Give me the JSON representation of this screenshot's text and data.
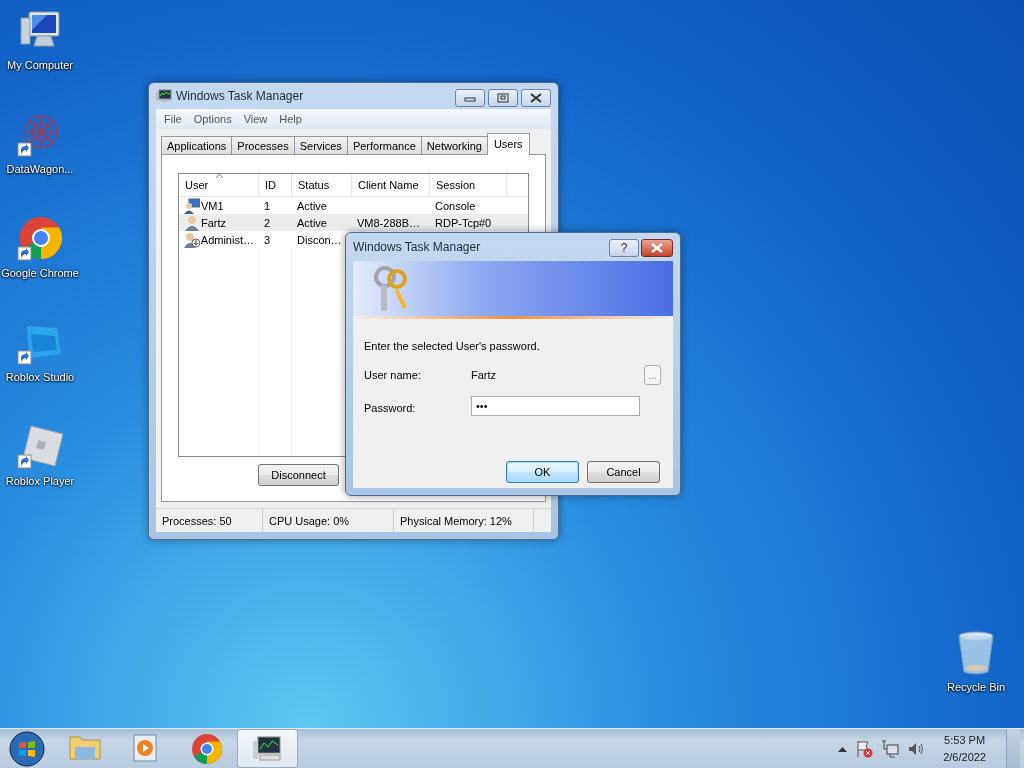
{
  "desktop_icons": [
    {
      "label": "My Computer",
      "kind": "computer",
      "shortcut": false
    },
    {
      "label": "DataWagon...",
      "kind": "network",
      "shortcut": true
    },
    {
      "label": "Google Chrome",
      "kind": "chrome",
      "shortcut": true
    },
    {
      "label": "Roblox Studio",
      "kind": "studio",
      "shortcut": true
    },
    {
      "label": "Roblox Player",
      "kind": "player",
      "shortcut": true
    }
  ],
  "recycle_bin": {
    "label": "Recycle Bin"
  },
  "task_manager": {
    "title": "Windows Task Manager",
    "menu": [
      "File",
      "Options",
      "View",
      "Help"
    ],
    "tabs": [
      {
        "label": "Applications",
        "selected": false
      },
      {
        "label": "Processes",
        "selected": false
      },
      {
        "label": "Services",
        "selected": false
      },
      {
        "label": "Performance",
        "selected": false
      },
      {
        "label": "Networking",
        "selected": false
      },
      {
        "label": "Users",
        "selected": true
      }
    ],
    "columns": [
      "User",
      "ID",
      "Status",
      "Client Name",
      "Session"
    ],
    "rows": [
      {
        "kind": "console",
        "selected": false,
        "cells": [
          "VM1",
          "1",
          "Active",
          "",
          "Console"
        ]
      },
      {
        "kind": "user",
        "selected": true,
        "cells": [
          "Fartz",
          "2",
          "Active",
          "VM8-288B…",
          "RDP-Tcp#0"
        ]
      },
      {
        "kind": "disconnected",
        "selected": false,
        "cells": [
          "Administ…",
          "3",
          "Discon…"
        ]
      }
    ],
    "buttons": [
      "Disconnect"
    ],
    "status_bar": [
      "Processes: 50",
      "CPU Usage: 0%",
      "Physical Memory: 12%"
    ]
  },
  "dialog": {
    "title": "Windows Task Manager",
    "help_button": "?",
    "message": "Enter the selected User's password.",
    "user_label": "User name:",
    "user_value": "Fartz",
    "browse_button": "...",
    "password_label": "Password:",
    "password_value": "•••",
    "buttons": [
      {
        "label": "OK",
        "default": true
      },
      {
        "label": "Cancel",
        "default": false
      }
    ]
  },
  "taskbar": {
    "apps": [
      {
        "kind": "folder",
        "selected": false
      },
      {
        "kind": "media",
        "selected": false
      },
      {
        "kind": "chrome",
        "selected": false
      },
      {
        "kind": "taskmgr",
        "selected": true
      }
    ],
    "time": "5:53 PM",
    "date": "2/6/2022"
  }
}
